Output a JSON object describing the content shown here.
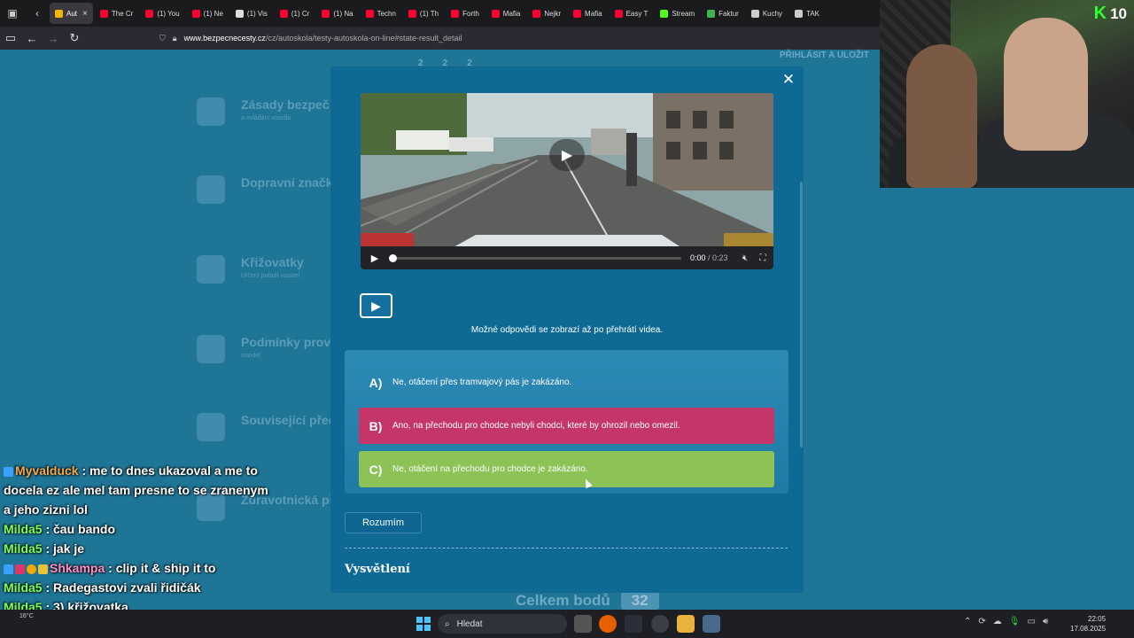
{
  "browser": {
    "tabs": [
      {
        "label": "Aut",
        "active": true,
        "color": "#f5b800"
      },
      {
        "label": "The Cr",
        "color": "#ff0033"
      },
      {
        "label": "(1) You",
        "color": "#ff0033"
      },
      {
        "label": "(1) Ne",
        "color": "#ff0033"
      },
      {
        "label": "(1) Vis",
        "color": "#dddddd"
      },
      {
        "label": "(1) Cr",
        "color": "#ff0033"
      },
      {
        "label": "(1) Na",
        "color": "#ff0033"
      },
      {
        "label": "Techn",
        "color": "#ff0033"
      },
      {
        "label": "(1) Th",
        "color": "#ff0033"
      },
      {
        "label": "Forth",
        "color": "#ff0033"
      },
      {
        "label": "Mafia",
        "color": "#ff0033"
      },
      {
        "label": "Nejkr",
        "color": "#ff0033"
      },
      {
        "label": "Mafia",
        "color": "#ff0033"
      },
      {
        "label": "Easy T",
        "color": "#ff0033"
      },
      {
        "label": "Stream",
        "color": "#53fc18"
      },
      {
        "label": "Faktur",
        "color": "#3fb34f"
      },
      {
        "label": "Kuchy",
        "color": "#cccccc"
      },
      {
        "label": "TAK",
        "color": "#cccccc"
      }
    ],
    "url_host": "www.bezpecnecesty.cz",
    "url_path": "/cz/autoskola/testy-autoskola-on-line#state-result_detail"
  },
  "background": {
    "steps": [
      "2",
      "2",
      "2"
    ],
    "login": "PŘIHLÁSIT A ULOŽIT",
    "categories": [
      {
        "title": "Zásady bezpeč",
        "sub": "a ovládání vozidla"
      },
      {
        "title": "Dopravní značk",
        "sub": ""
      },
      {
        "title": "Křižovatky",
        "sub": "Určení pořadí vozidel"
      },
      {
        "title": "Podmínky prov",
        "sub": "vozidel"
      },
      {
        "title": "Související před",
        "sub": ""
      },
      {
        "title": "Zdravotnická př",
        "sub": ""
      }
    ],
    "score_label": "Celkem bodů",
    "score_value": "32"
  },
  "modal": {
    "close_icon": "✕",
    "video": {
      "time_current": "0:00",
      "time_total": "/ 0:23",
      "progress": 0.0
    },
    "hint": "Možné odpovědi se zobrazí až po přehrátí videa.",
    "answers": [
      {
        "letter": "A)",
        "text": "Ne, otáčení přes tramvajový pás je zakázáno.",
        "state": "neutral"
      },
      {
        "letter": "B)",
        "text": "Ano, na přechodu pro chodce nebyli chodci, které by ohrozil nebo omezil.",
        "state": "wrong"
      },
      {
        "letter": "C)",
        "text": "Ne, otáčení na přechodu pro chodce je zakázáno.",
        "state": "correct"
      }
    ],
    "ok_label": "Rozumím",
    "explanation_title": "Vysvětlení"
  },
  "webcam": {
    "logo_letter": "K",
    "viewer_count": "10"
  },
  "chat": [
    {
      "user": "Myvalduck",
      "user_color": "#f0a94a",
      "text": " : me to dnes ukazoval a me to docela ez ale mel tam presne to se zranenym a jeho zizni lol"
    },
    {
      "user": "Milda5",
      "user_color": "#7dff5a",
      "text": " : čau bando"
    },
    {
      "user": "Milda5",
      "user_color": "#7dff5a",
      "text": " : jak je"
    },
    {
      "user": "Shkampa",
      "user_color": "#ff8fc7",
      "text": " : clip it & ship it to"
    },
    {
      "user": "Milda5",
      "user_color": "#7dff5a",
      "text": " : Radegastovi zvali řidičák"
    },
    {
      "user": "Milda5",
      "user_color": "#7dff5a",
      "text": " : 3) křižovatka"
    }
  ],
  "taskbar": {
    "weather": "16°C",
    "search_placeholder": "Hledat",
    "time": "22:05",
    "date": "17.08.2025"
  }
}
